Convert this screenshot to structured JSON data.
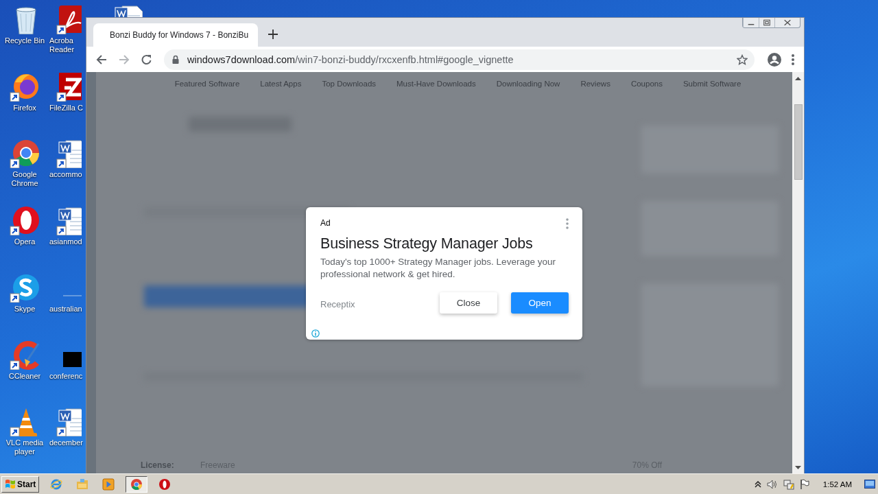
{
  "desktop": {
    "columns": [
      [
        {
          "kind": "recycle-bin",
          "lines": [
            "Recycle Bin"
          ]
        },
        {
          "kind": "firefox",
          "lines": [
            "Firefox"
          ]
        },
        {
          "kind": "chrome",
          "lines": [
            "Google",
            "Chrome"
          ]
        },
        {
          "kind": "opera",
          "lines": [
            "Opera"
          ]
        },
        {
          "kind": "skype",
          "lines": [
            "Skype"
          ]
        },
        {
          "kind": "ccleaner",
          "lines": [
            "CCleaner"
          ]
        },
        {
          "kind": "vlc",
          "lines": [
            "VLC media",
            "player"
          ]
        }
      ],
      [
        {
          "kind": "pdf",
          "lines": [
            "Acroba",
            "Reader"
          ]
        },
        {
          "kind": "filezilla",
          "lines": [
            "FileZilla C"
          ]
        },
        {
          "kind": "word",
          "lines": [
            "accommo"
          ]
        },
        {
          "kind": "word",
          "lines": [
            "asianmod"
          ]
        },
        {
          "kind": "blank",
          "lines": [
            "australian"
          ]
        },
        {
          "kind": "black",
          "lines": [
            "conferenc"
          ]
        },
        {
          "kind": "word",
          "lines": [
            "december"
          ]
        }
      ],
      [
        {
          "kind": "word"
        }
      ]
    ]
  },
  "browser": {
    "tabs": [
      {
        "title": "Bonzi Buddy for Windows 7 - BonziBu",
        "selected": true
      }
    ],
    "nav": [
      {
        "kind": "back",
        "disabled": false
      },
      {
        "kind": "forward",
        "disabled": true
      },
      {
        "kind": "reload",
        "disabled": false
      }
    ],
    "address": {
      "host": "windows7download.com",
      "path": "/win7-bonzi-buddy/rxcxenfb.html#google_vignette"
    },
    "page": {
      "nav": [
        "Featured Software",
        "Latest Apps",
        "Top Downloads",
        "Must-Have Downloads",
        "Downloading Now",
        "Reviews",
        "Coupons",
        "Submit Software"
      ],
      "license_label": "License:",
      "license_value": "Freeware",
      "deal": "70% Off"
    },
    "ad": {
      "badge": "Ad",
      "title": "Business Strategy Manager Jobs",
      "body": "Today's top 1000+ Strategy Manager jobs. Leverage your professional network & get hired.",
      "advertiser": "Receptix",
      "buttons": [
        {
          "label": "Close",
          "kind": "secondary"
        },
        {
          "label": "Open",
          "kind": "primary"
        }
      ]
    }
  },
  "taskbar": {
    "start": "Start",
    "apps": [
      {
        "kind": "ie",
        "selected": false
      },
      {
        "kind": "explorer",
        "selected": false
      },
      {
        "kind": "media",
        "selected": false
      },
      {
        "kind": "chrome",
        "selected": true
      },
      {
        "kind": "opera",
        "selected": false
      }
    ],
    "clock": "1:52 AM"
  }
}
